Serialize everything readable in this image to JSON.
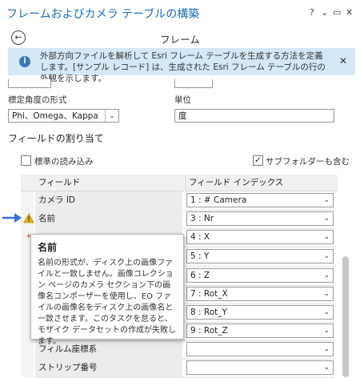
{
  "title": "フレームおよびカメラ テーブルの構築",
  "titlebar": {
    "help": "?",
    "menu": "⌄",
    "pin": "▭",
    "close": "✕"
  },
  "nav": {
    "back": "←",
    "title": "フレーム"
  },
  "info": {
    "icon": "i",
    "message": "外部方向ファイルを解析して Esri フレーム テーブルを生成する方法を定義します。[サンプル レコード] は、生成された Esri フレーム テーブルの行の外観を示します。",
    "close": "✕"
  },
  "orientation": {
    "label": "標定角度の形式",
    "value": "Phi、Omega、Kappa"
  },
  "unit": {
    "label": "単位",
    "value": "度"
  },
  "fields_section": {
    "title": "フィールドの割り当て",
    "load_standard": "標準の読み込み",
    "include_subfolders": "サブフォルダーも含む"
  },
  "table": {
    "headers": {
      "field": "フィールド",
      "index": "フィールド インデックス"
    },
    "rows": [
      {
        "field": "カメラ ID",
        "index": "1 : # Camera"
      },
      {
        "field": "名前",
        "index": "3 : Nr"
      },
      {
        "field": "",
        "index": "4 : X"
      },
      {
        "field": "",
        "index": "5 : Y"
      },
      {
        "field": "",
        "index": "6 : Z"
      },
      {
        "field": "",
        "index": "7 : Rot_X"
      },
      {
        "field": "",
        "index": "8 : Rot_Y"
      },
      {
        "field": "",
        "index": "9 : Rot_Z"
      },
      {
        "field": "フィルム座標系",
        "index": ""
      },
      {
        "field": "ストリップ番号",
        "index": ""
      }
    ]
  },
  "tooltip": {
    "title": "名前",
    "body": "名前の形式が、ディスク上の画像ファイルと一致しません。画像コレクション ページのカメラ セクション下の画像名コンポーザーを使用し、EO ファイルの画像名をディスク上の画像名と一致させます。このタスクを怠ると、モザイク データセットの作成が失敗します。"
  },
  "colors": {
    "accent": "#1b6fb8",
    "info_bg": "#d4e8f8",
    "warning": "#f0b400",
    "arrow": "#3a6fd8"
  }
}
